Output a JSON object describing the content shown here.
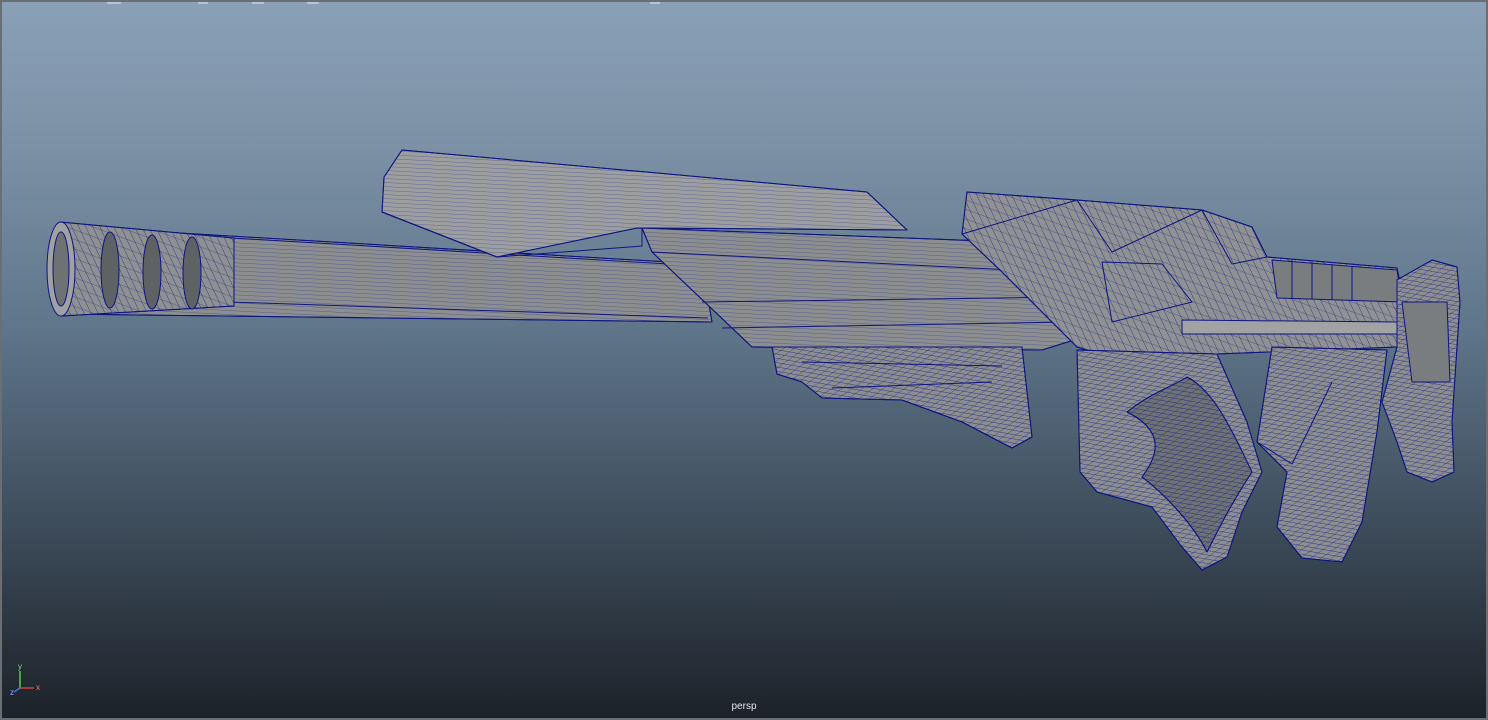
{
  "viewport": {
    "camera_label": "persp",
    "axis": {
      "x_label": "x",
      "y_label": "y",
      "z_label": "z"
    }
  },
  "colors": {
    "wireframe": "#0d1580",
    "surface": "#8c8e90",
    "surface_light": "#a3a5a7",
    "surface_dark": "#6d7072"
  },
  "icons": [
    "axis-gizmo-icon"
  ]
}
